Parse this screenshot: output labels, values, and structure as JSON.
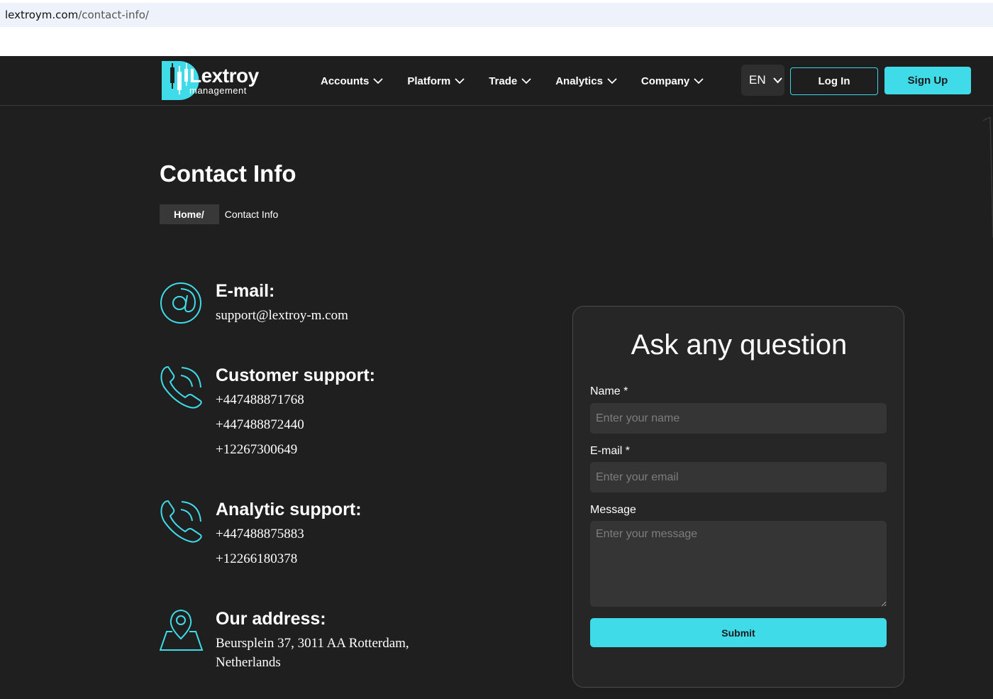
{
  "browser": {
    "url_host": "lextroym.com",
    "url_path": "/contact-info/"
  },
  "header": {
    "logo_name": "Lextroy",
    "logo_sub": "management",
    "nav": [
      {
        "label": "Accounts"
      },
      {
        "label": "Platform"
      },
      {
        "label": "Trade"
      },
      {
        "label": "Analytics"
      },
      {
        "label": "Company"
      }
    ],
    "language": "EN",
    "login_label": "Log In",
    "signup_label": "Sign Up"
  },
  "page": {
    "title": "Contact Info",
    "breadcrumb_home": "Home/",
    "breadcrumb_current": "Contact Info"
  },
  "contacts": {
    "email": {
      "title": "E-mail:",
      "lines": [
        "support@lextroy-m.com"
      ]
    },
    "customer": {
      "title": "Customer support:",
      "lines": [
        "+447488871768",
        "+447488872440",
        "+12267300649"
      ]
    },
    "analytic": {
      "title": "Analytic support:",
      "lines": [
        "+447488875883",
        "+12266180378"
      ]
    },
    "address": {
      "title": "Our address:",
      "lines": [
        "Beursplein 37, 3011 AA Rotterdam,",
        "Netherlands"
      ]
    }
  },
  "form": {
    "title": "Ask any question",
    "name_label": "Name *",
    "name_placeholder": "Enter your name",
    "email_label": "E-mail *",
    "email_placeholder": "Enter your email",
    "message_label": "Message",
    "message_placeholder": "Enter your message",
    "submit_label": "Submit"
  },
  "colors": {
    "accent": "#3fdbe9",
    "background": "#1f1f1f",
    "card": "#262626",
    "input": "#353535"
  },
  "icons": [
    "at-sign-icon",
    "phone-icon",
    "map-pin-icon",
    "chevron-down-icon"
  ]
}
